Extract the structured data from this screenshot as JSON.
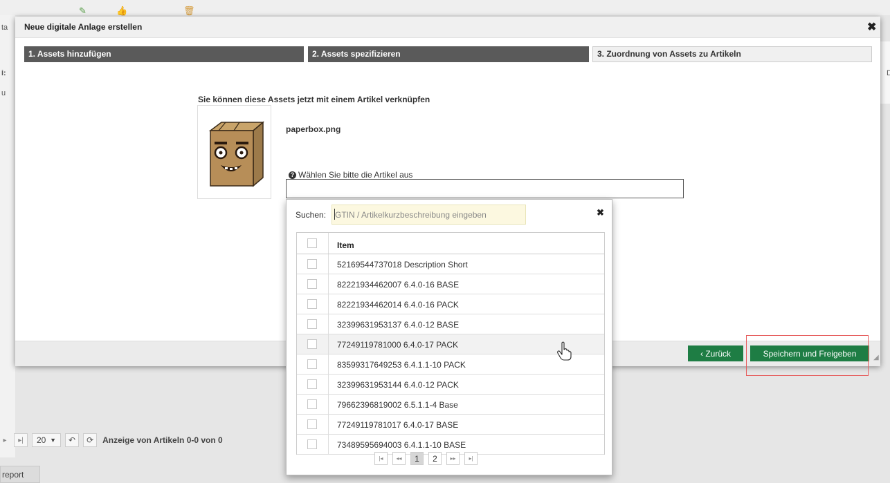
{
  "background": {
    "left_strip_labels": [
      "ta",
      "i:",
      "u"
    ],
    "right_strip_label": "D",
    "pager": {
      "first_icon": "first-page-icon",
      "page_size": "20",
      "refresh_icon": "refresh-icon",
      "status_text": "Anzeige von Artikeln 0-0 von 0"
    },
    "report_tab": "report"
  },
  "modal": {
    "title": "Neue digitale Anlage erstellen",
    "close_glyph": "✖",
    "steps": [
      {
        "label": "1. Assets hinzufügen",
        "state": "done"
      },
      {
        "label": "2. Assets spezifizieren",
        "state": "done"
      },
      {
        "label": "3. Zuordnung von Assets zu Artikeln",
        "state": "current"
      }
    ],
    "intro_text": "Sie können diese Assets jetzt mit einem Artikel verknüpfen",
    "asset": {
      "filename": "paperbox.png"
    },
    "choose_label": "Wählen Sie bitte die Artikel aus",
    "buttons": {
      "back": "‹ Zurück",
      "save_release": "Speichern und Freigeben"
    },
    "accent_color": "#1e7d44"
  },
  "dropdown": {
    "search_label": "Suchen:",
    "search_placeholder": "GTIN / Artikelkurzbeschreibung eingeben",
    "close_glyph": "✖",
    "column_header": "Item",
    "items": [
      "52169544737018 Description Short",
      "82221934462007 6.4.0-16 BASE",
      "82221934462014 6.4.0-16 PACK",
      "32399631953137 6.4.0-12 BASE",
      "77249119781000 6.4.0-17 PACK",
      "83599317649253 6.4.1.1-10 PACK",
      "32399631953144 6.4.0-12 PACK",
      "79662396819002 6.5.1.1-4 Base",
      "77249119781017 6.4.0-17 BASE",
      "73489595694003 6.4.1.1-10 BASE"
    ],
    "hovered_item_index": 4,
    "pagination": {
      "pages": [
        "1",
        "2"
      ],
      "current_page": "1"
    }
  }
}
